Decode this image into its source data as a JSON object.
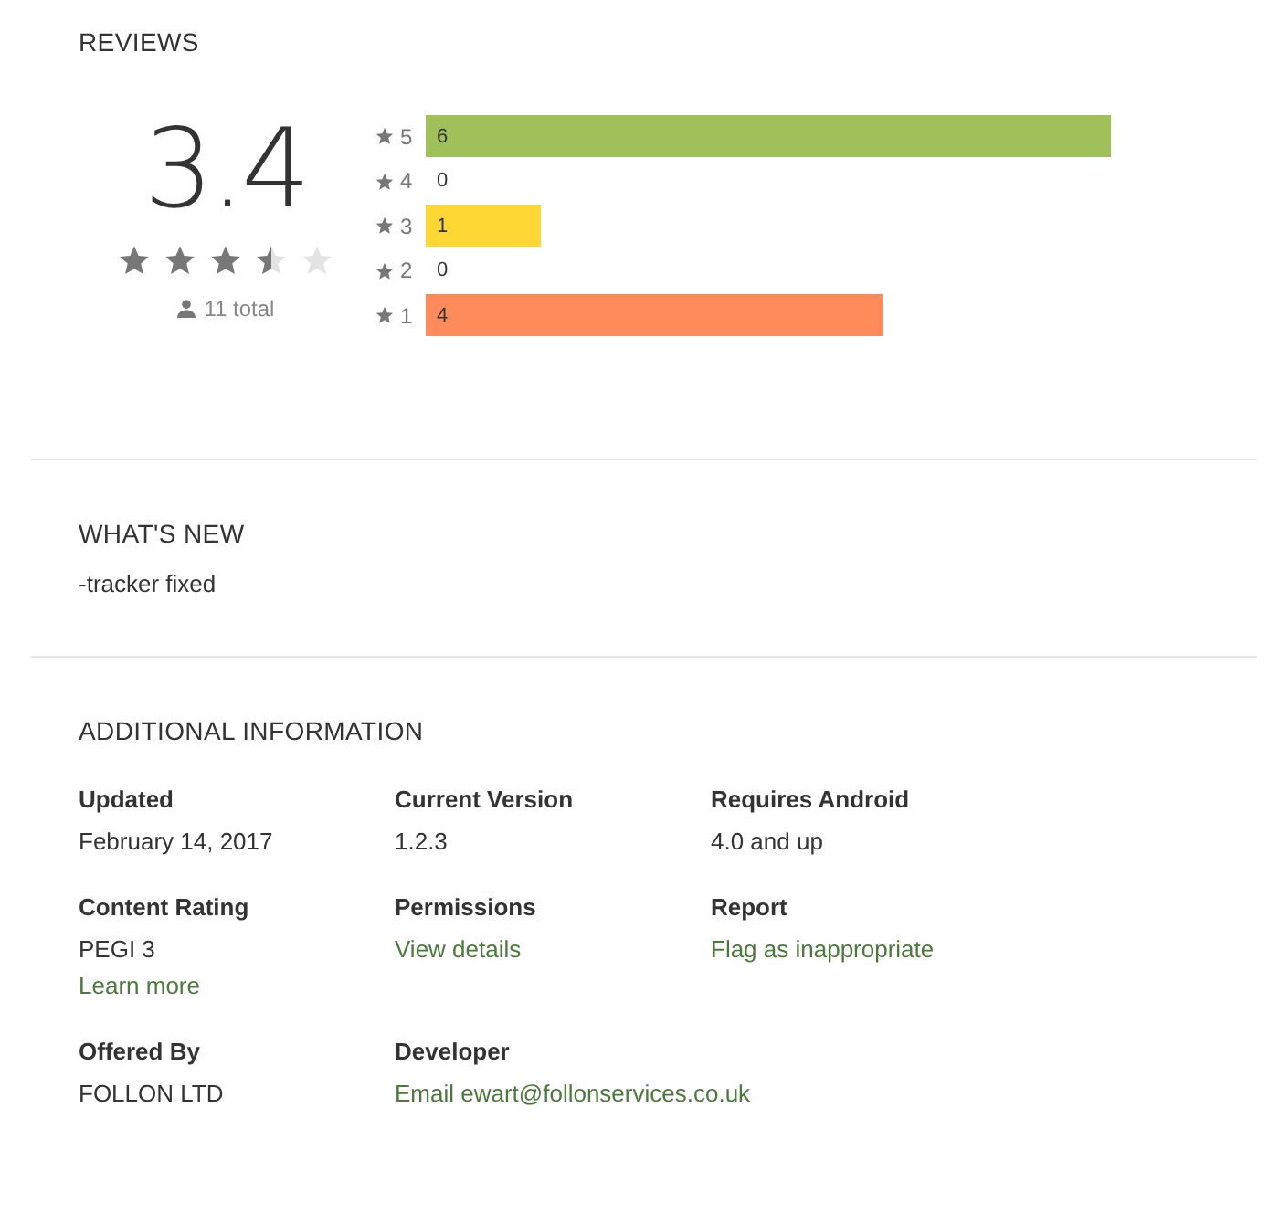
{
  "reviews": {
    "title": "REVIEWS",
    "score": "3.4",
    "stars": 3.5,
    "total": "11 total",
    "bars": [
      {
        "star": "5",
        "count": "6",
        "color": "#a0c15a"
      },
      {
        "star": "4",
        "count": "0"
      },
      {
        "star": "3",
        "count": "1",
        "color": "#ffd735"
      },
      {
        "star": "2",
        "count": "0"
      },
      {
        "star": "1",
        "count": "4",
        "color": "#ff8b5a"
      }
    ]
  },
  "whats_new": {
    "title": "WHAT'S NEW",
    "text": "-tracker fixed"
  },
  "additional_info": {
    "title": "ADDITIONAL INFORMATION",
    "items": [
      {
        "label": "Updated",
        "values": [
          {
            "kind": "text",
            "text": "February 14, 2017"
          }
        ]
      },
      {
        "label": "Current Version",
        "values": [
          {
            "kind": "text",
            "text": "1.2.3"
          }
        ]
      },
      {
        "label": "Requires Android",
        "values": [
          {
            "kind": "text",
            "text": "4.0 and up"
          }
        ]
      },
      {
        "label": "Content Rating",
        "values": [
          {
            "kind": "text",
            "text": "PEGI 3"
          },
          {
            "kind": "link",
            "text": "Learn more"
          }
        ]
      },
      {
        "label": "Permissions",
        "values": [
          {
            "kind": "link",
            "text": "View details"
          }
        ]
      },
      {
        "label": "Report",
        "values": [
          {
            "kind": "link",
            "text": "Flag as inappropriate"
          }
        ]
      },
      {
        "label": "Offered By",
        "values": [
          {
            "kind": "text",
            "text": "FOLLON LTD"
          }
        ]
      },
      {
        "label": "Developer",
        "values": [
          {
            "kind": "link",
            "text": "Email ewart@follonservices.co.uk"
          }
        ]
      }
    ]
  }
}
